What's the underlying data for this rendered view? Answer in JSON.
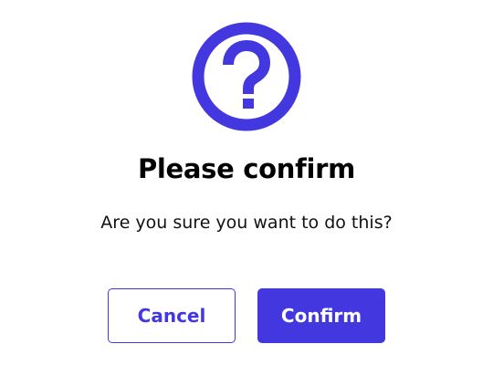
{
  "dialog": {
    "icon": "question-circle-icon",
    "title": "Please confirm",
    "message": "Are you sure you want to do this?",
    "cancel_label": "Cancel",
    "confirm_label": "Confirm"
  },
  "colors": {
    "accent": "#4338e0",
    "background": "#ffffff",
    "title_text": "#000000"
  }
}
